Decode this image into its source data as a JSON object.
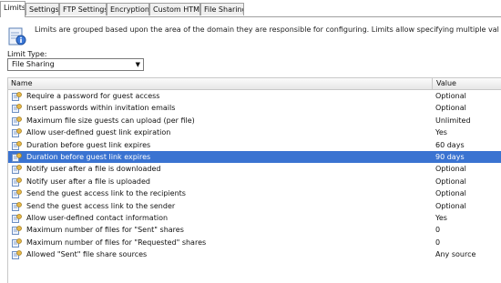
{
  "tabs": [
    "Limits",
    "Settings",
    "FTP Settings",
    "Encryption",
    "Custom HTML",
    "File Sharing"
  ],
  "description": "Limits are grouped based upon the area of the domain they are responsible for configuring. Limits allow specifying multiple values for the sam",
  "limit_type": {
    "label": "Limit Type:",
    "selected": "File Sharing"
  },
  "columns": {
    "name": "Name",
    "value": "Value"
  },
  "rows": [
    {
      "name": "Require a password for guest access",
      "value": "Optional"
    },
    {
      "name": "Insert passwords within invitation emails",
      "value": "Optional"
    },
    {
      "name": "Maximum file size guests can upload (per file)",
      "value": "Unlimited"
    },
    {
      "name": "Allow user-defined guest link expiration",
      "value": "Yes"
    },
    {
      "name": "Duration before guest link expires",
      "value": "60 days"
    },
    {
      "name": "Duration before guest link expires",
      "value": "90 days"
    },
    {
      "name": "Notify user after a file is downloaded",
      "value": "Optional"
    },
    {
      "name": "Notify user after a file is uploaded",
      "value": "Optional"
    },
    {
      "name": "Send the guest access link to the recipients",
      "value": "Optional"
    },
    {
      "name": "Send the guest access link to the sender",
      "value": "Optional"
    },
    {
      "name": "Allow user-defined contact information",
      "value": "Yes"
    },
    {
      "name": "Maximum number of files for \"Sent\" shares",
      "value": "0"
    },
    {
      "name": "Maximum number of files for \"Requested\" shares",
      "value": "0"
    },
    {
      "name": "Allowed \"Sent\" file share sources",
      "value": "Any source"
    }
  ],
  "selected_row": 5,
  "colors": {
    "selection": "#3a73d1",
    "tab_border": "#a0a0a0"
  }
}
